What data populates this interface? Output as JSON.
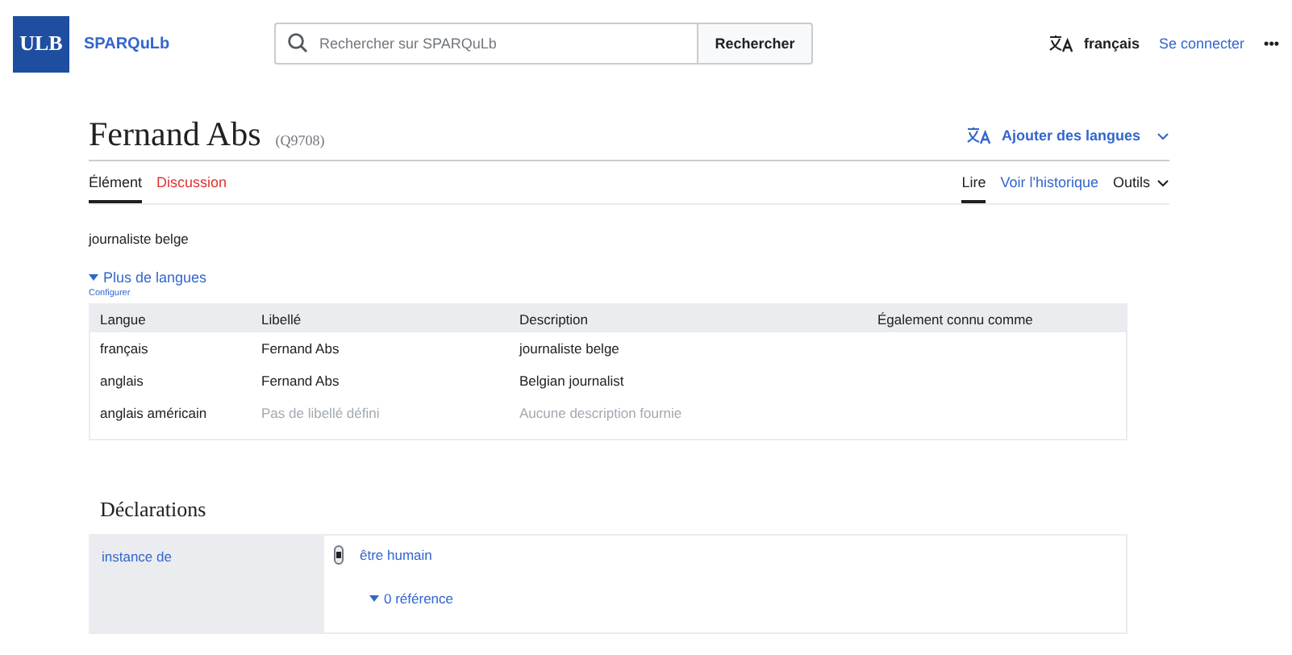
{
  "header": {
    "logo": "ULB",
    "site_name": "SPARQuLb",
    "search": {
      "placeholder": "Rechercher sur SPARQuLb",
      "button": "Rechercher"
    },
    "language": "français",
    "login": "Se connecter",
    "more": "•••"
  },
  "page": {
    "title": "Fernand Abs",
    "id": "(Q9708)",
    "add_languages": "Ajouter des langues",
    "left_tabs": [
      {
        "label": "Élément",
        "selected": true,
        "kind": "normal"
      },
      {
        "label": "Discussion",
        "selected": false,
        "kind": "missing"
      }
    ],
    "right_tabs": [
      {
        "label": "Lire",
        "selected": true
      },
      {
        "label": "Voir l'historique",
        "selected": false
      },
      {
        "label": "Outils",
        "selected": false,
        "kind": "menu"
      }
    ]
  },
  "description": "journaliste belge",
  "more_languages": {
    "label": "Plus de langues",
    "configure": "Configurer"
  },
  "table": {
    "columns": [
      "Langue",
      "Libellé",
      "Description",
      "Également connu comme"
    ],
    "rows": [
      {
        "language": "français",
        "label": "Fernand Abs",
        "description": "journaliste belge",
        "missing": false
      },
      {
        "language": "anglais",
        "label": "Fernand Abs",
        "description": "Belgian journalist",
        "missing": false
      },
      {
        "language": "anglais américain",
        "label": "Pas de libellé défini",
        "description": "Aucune description fournie",
        "missing": true
      }
    ]
  },
  "statements": {
    "heading": "Déclarations",
    "items": [
      {
        "property": "instance de",
        "value": "être humain",
        "references": "0 référence"
      }
    ]
  }
}
